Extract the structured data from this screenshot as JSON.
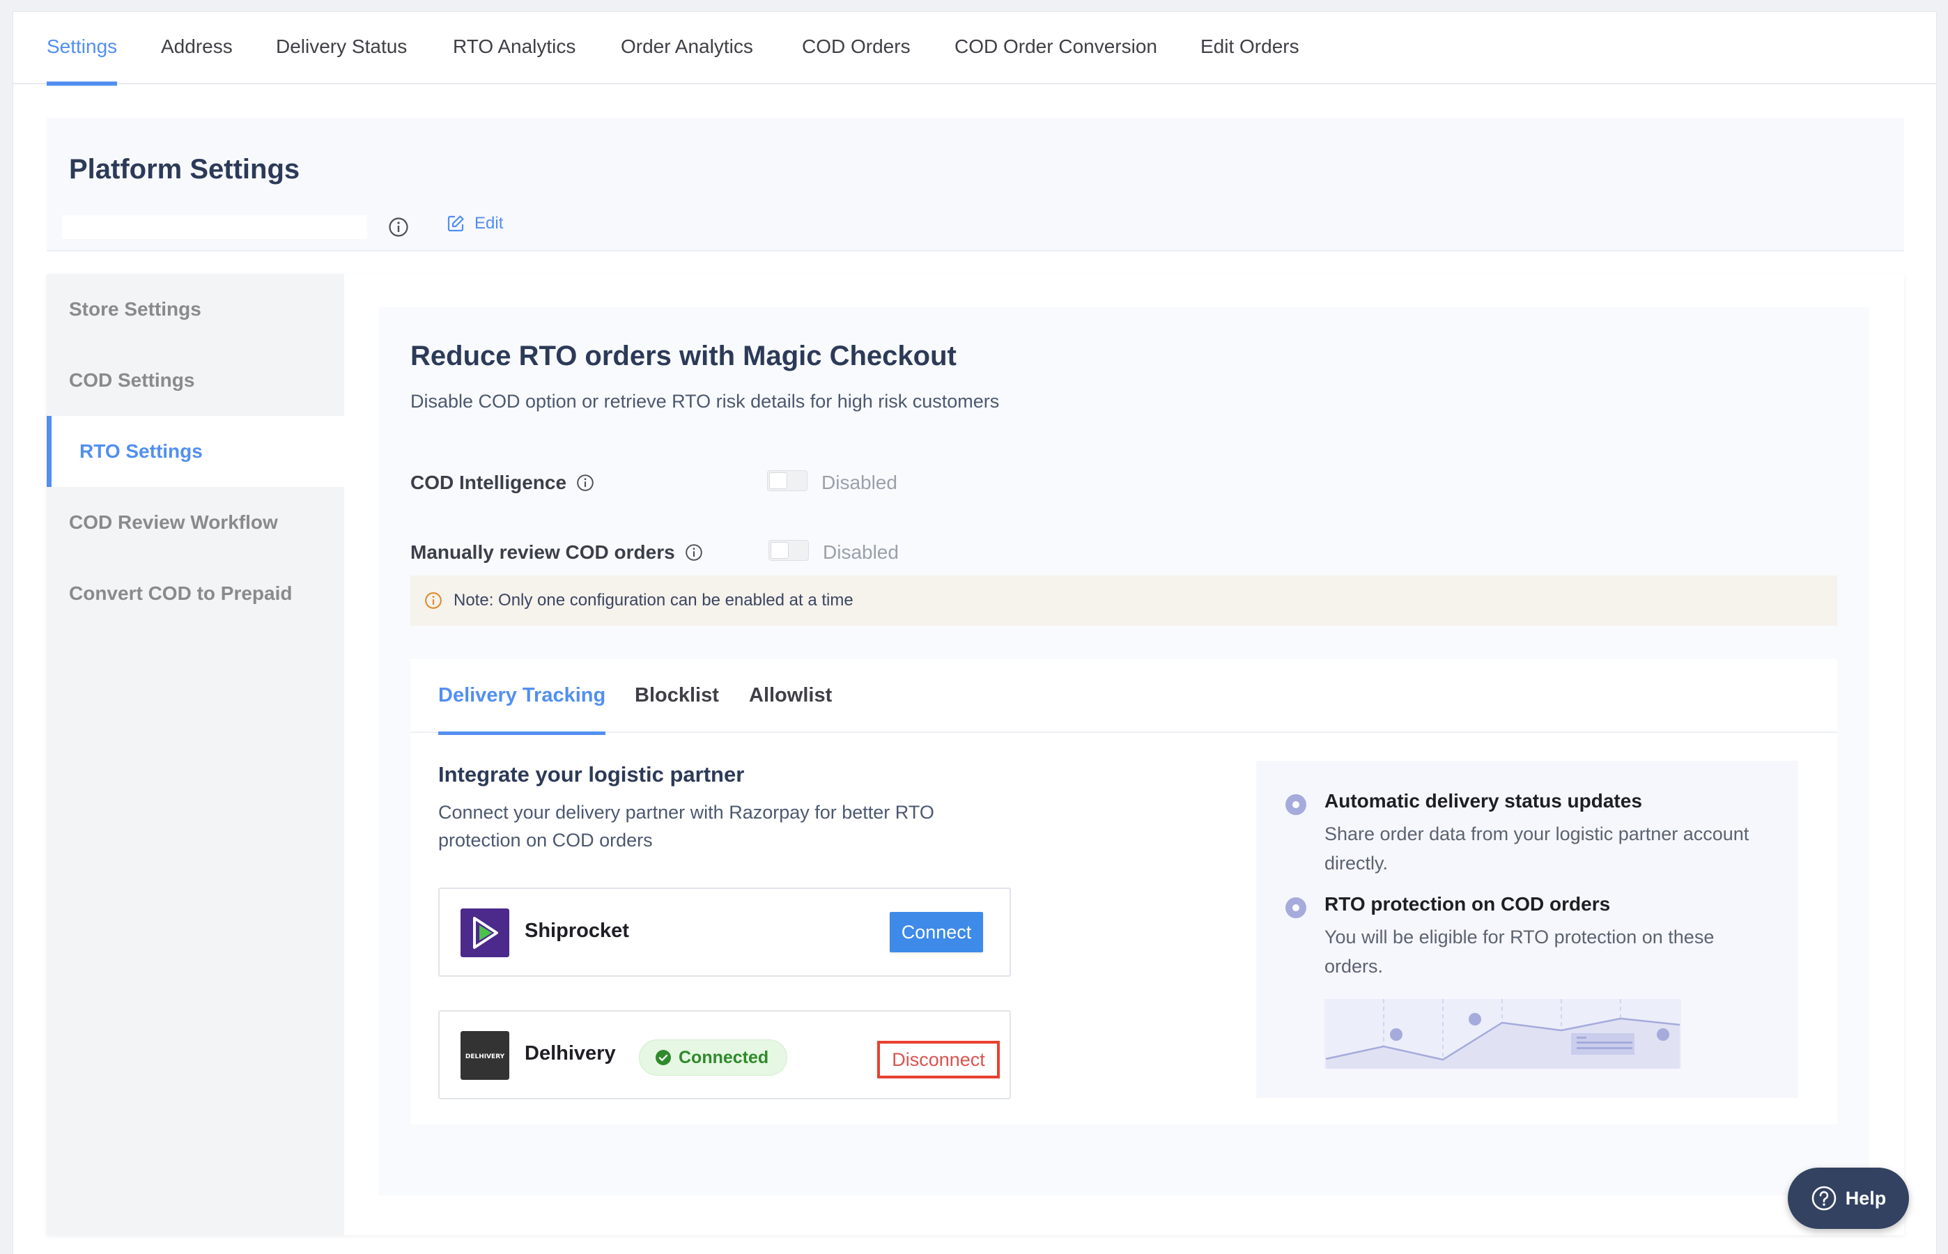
{
  "topnav": {
    "tabs": [
      {
        "label": "Settings",
        "active": true
      },
      {
        "label": "Address",
        "active": false
      },
      {
        "label": "Delivery Status",
        "active": false
      },
      {
        "label": "RTO Analytics",
        "active": false
      },
      {
        "label": "Order Analytics",
        "active": false
      },
      {
        "label": "COD Orders",
        "active": false
      },
      {
        "label": "COD Order Conversion",
        "active": false
      },
      {
        "label": "Edit Orders",
        "active": false
      }
    ]
  },
  "platform": {
    "title": "Platform Settings",
    "info_icon": "info-icon",
    "edit_label": "Edit",
    "edit_icon": "edit-icon"
  },
  "sidebar": {
    "items": [
      {
        "label": "Store Settings",
        "active": false
      },
      {
        "label": "COD Settings",
        "active": false
      },
      {
        "label": "RTO Settings",
        "active": true
      },
      {
        "label": "COD Review Workflow",
        "active": false
      },
      {
        "label": "Convert COD to Prepaid",
        "active": false
      }
    ]
  },
  "rto": {
    "title": "Reduce RTO orders with Magic Checkout",
    "subtitle": "Disable COD option or retrieve RTO risk details for high risk customers",
    "configs": [
      {
        "label": "COD Intelligence",
        "state": "Disabled",
        "enabled": false
      },
      {
        "label": "Manually review COD orders",
        "state": "Disabled",
        "enabled": false
      }
    ],
    "note": "Note: Only one configuration can be enabled at a time"
  },
  "subtabs": {
    "tabs": [
      {
        "label": "Delivery Tracking",
        "active": true
      },
      {
        "label": "Blocklist",
        "active": false
      },
      {
        "label": "Allowlist",
        "active": false
      }
    ]
  },
  "integrate": {
    "title": "Integrate your logistic partner",
    "description": "Connect your delivery partner with Razorpay for better RTO protection on COD orders",
    "partners": [
      {
        "name": "Shiprocket",
        "logo_color": "#4b2a8c",
        "action": "Connect",
        "status": null
      },
      {
        "name": "Delhivery",
        "logo_text": "DELHIVERY",
        "logo_color": "#333333",
        "action": "Disconnect",
        "status": "Connected"
      }
    ]
  },
  "features": [
    {
      "title": "Automatic delivery status updates",
      "description": "Share order data from your logistic partner account directly."
    },
    {
      "title": "RTO protection on COD orders",
      "description": "You will be eligible for RTO protection on these orders."
    }
  ],
  "help": {
    "label": "Help"
  },
  "colors": {
    "accent": "#528ff0",
    "connect_button": "#3d8ae8",
    "disconnect_text": "#d9534f",
    "disconnect_outline": "#e8412f",
    "connected_badge": "#2f8a2b",
    "help_bg": "#334261"
  }
}
